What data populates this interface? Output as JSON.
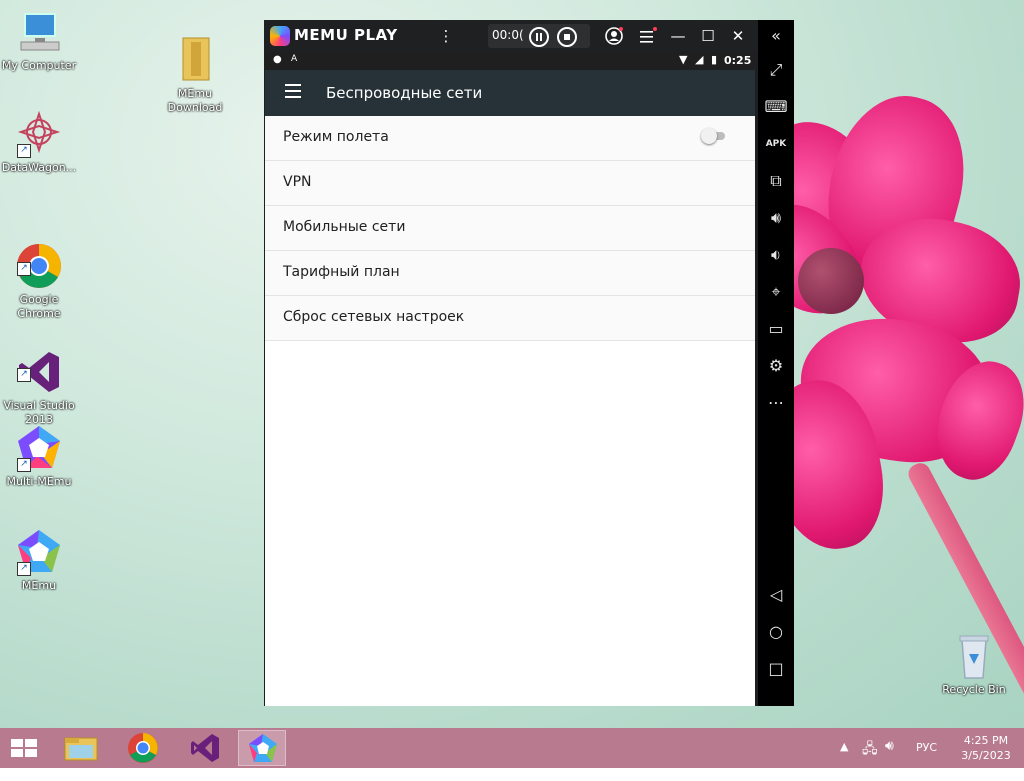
{
  "desktop": {
    "icons": [
      {
        "label": "My Computer"
      },
      {
        "label": "MEmu\nDownload"
      },
      {
        "label": "DataWagon..."
      },
      {
        "label": "Google\nChrome"
      },
      {
        "label": "Visual Studio\n2013"
      },
      {
        "label": "Multi-MEmu"
      },
      {
        "label": "MEmu"
      },
      {
        "label": "Recycle Bin"
      }
    ]
  },
  "emulator": {
    "logo_text": "MEMU PLAY",
    "record_time": "00:0(",
    "status_time": "0:25",
    "app_title": "Беспроводные сети",
    "rows": [
      {
        "label": "Режим полета"
      },
      {
        "label": "VPN"
      },
      {
        "label": "Мобильные сети"
      },
      {
        "label": "Тарифный план"
      },
      {
        "label": "Сброс сетевых настроек"
      }
    ],
    "airplane_mode_on": false
  },
  "taskbar": {
    "language": "РУС",
    "time": "4:25 PM",
    "date": "3/5/2023"
  },
  "colors": {
    "appbar": "#263238",
    "taskbar": "#b87a8f"
  }
}
